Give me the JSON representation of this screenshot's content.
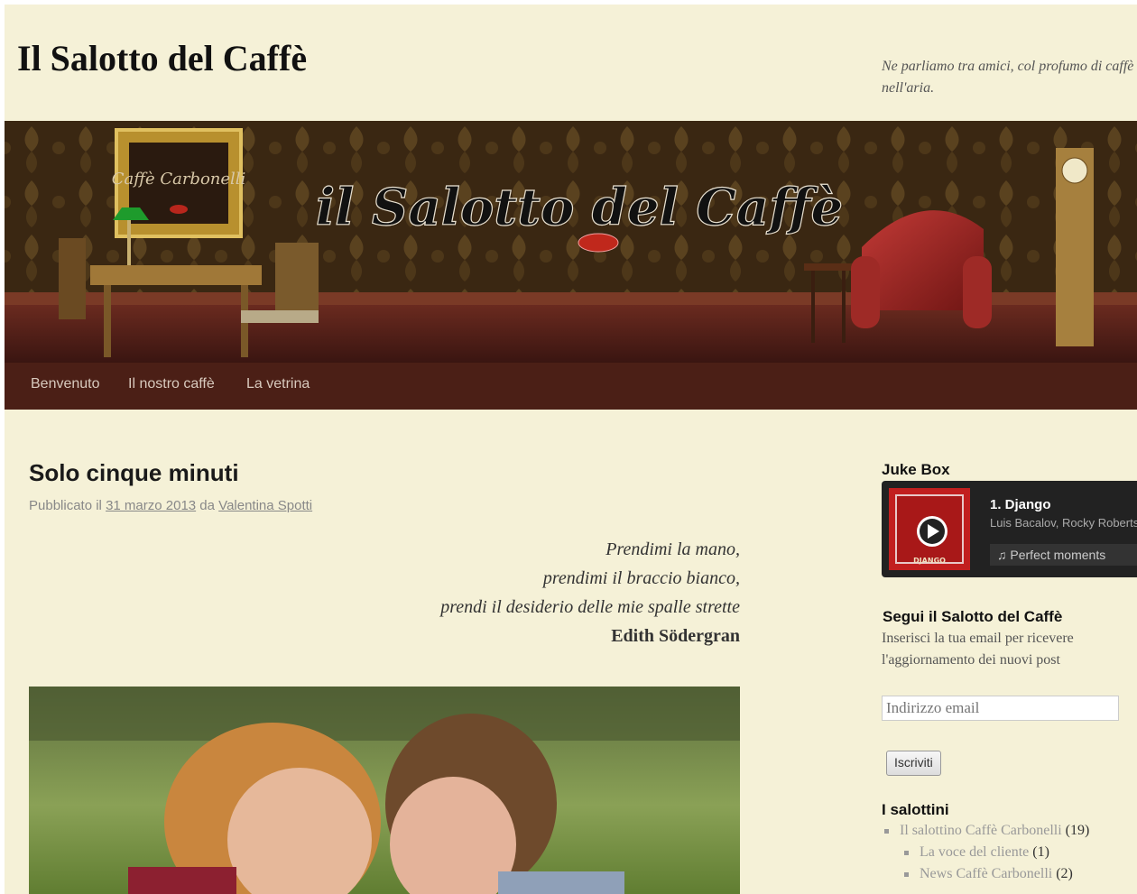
{
  "header": {
    "site_title": "Il Salotto del Caffè",
    "tagline": "Ne parliamo tra amici, col profumo di caffè nell'aria."
  },
  "banner": {
    "painting_text": "Caffè Carbonelli",
    "logo_text": "il Salotto del Caffè"
  },
  "nav": {
    "items": [
      {
        "label": "Benvenuto"
      },
      {
        "label": "Il nostro caffè"
      },
      {
        "label": "La vetrina"
      }
    ]
  },
  "post": {
    "title": "Solo cinque minuti",
    "meta": {
      "prefix": "Pubblicato il ",
      "date": "31 marzo 2013",
      "by": " da ",
      "author": "Valentina Spotti"
    },
    "poem": {
      "lines": [
        "Prendimi la mano,",
        "prendimi il braccio bianco,",
        "prendi il desiderio delle mie spalle strette"
      ],
      "author": "Edith Södergran"
    }
  },
  "sidebar": {
    "jukebox": {
      "title": "Juke Box",
      "track": "1. Django",
      "artist": "Luis Bacalov, Rocky Roberts",
      "album": "Perfect moments",
      "album_icon": "music-note-icon",
      "cover_text": "DJANGO"
    },
    "follow": {
      "title": "Segui il Salotto del Caffè",
      "description": "Inserisci la tua email per ricevere l'aggiornamento dei nuovi post",
      "email_placeholder": "Indirizzo email",
      "button": "Iscriviti"
    },
    "categories": {
      "title": "I salottini",
      "items": [
        {
          "label": "Il salottino Caffè Carbonelli",
          "count": "(19)"
        },
        {
          "label": "La voce del cliente",
          "count": "(1)"
        },
        {
          "label": "News Caffè Carbonelli",
          "count": "(2)"
        }
      ]
    }
  },
  "colors": {
    "page_bg": "#f5f1d7",
    "nav_bg": "#4b1f16",
    "nav_text": "#d8c9bd"
  }
}
